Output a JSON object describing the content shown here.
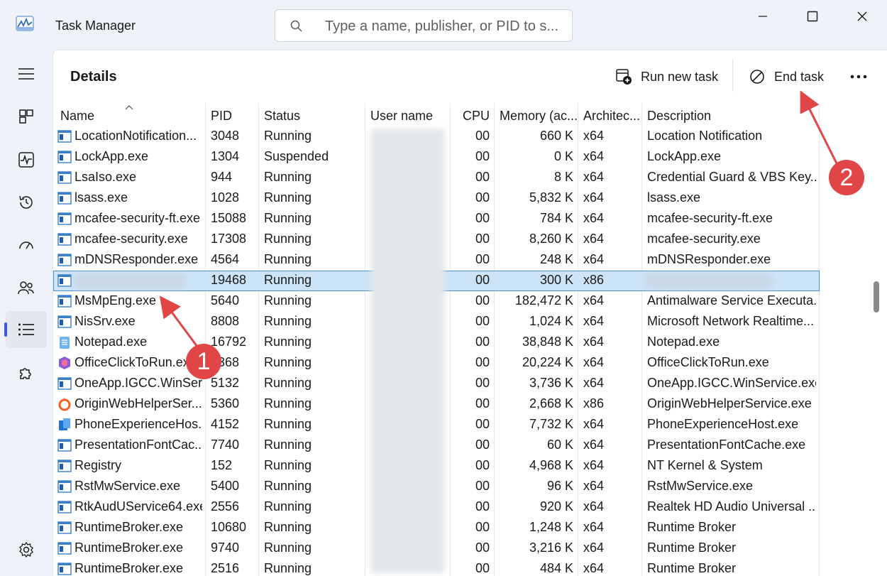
{
  "window": {
    "title": "Task Manager"
  },
  "search": {
    "placeholder": "Type a name, publisher, or PID to s..."
  },
  "toolbar": {
    "heading": "Details",
    "run_new_task": "Run new task",
    "end_task": "End task"
  },
  "columns": {
    "name": "Name",
    "pid": "PID",
    "status": "Status",
    "user": "User name",
    "cpu": "CPU",
    "memory": "Memory (ac...",
    "arch": "Architec...",
    "desc": "Description"
  },
  "rows": [
    {
      "name": "LocationNotification...",
      "pid": "3048",
      "status": "Running",
      "cpu": "00",
      "memory": "660 K",
      "arch": "x64",
      "desc": "Location Notification",
      "icon": "app"
    },
    {
      "name": "LockApp.exe",
      "pid": "1304",
      "status": "Suspended",
      "cpu": "00",
      "memory": "0 K",
      "arch": "x64",
      "desc": "LockApp.exe",
      "icon": "app"
    },
    {
      "name": "LsaIso.exe",
      "pid": "944",
      "status": "Running",
      "cpu": "00",
      "memory": "8 K",
      "arch": "x64",
      "desc": "Credential Guard & VBS Key...",
      "icon": "app"
    },
    {
      "name": "lsass.exe",
      "pid": "1028",
      "status": "Running",
      "cpu": "00",
      "memory": "5,832 K",
      "arch": "x64",
      "desc": "lsass.exe",
      "icon": "app"
    },
    {
      "name": "mcafee-security-ft.exe",
      "pid": "15088",
      "status": "Running",
      "cpu": "00",
      "memory": "784 K",
      "arch": "x64",
      "desc": "mcafee-security-ft.exe",
      "icon": "app"
    },
    {
      "name": "mcafee-security.exe",
      "pid": "17308",
      "status": "Running",
      "cpu": "00",
      "memory": "8,260 K",
      "arch": "x64",
      "desc": "mcafee-security.exe",
      "icon": "app"
    },
    {
      "name": "mDNSResponder.exe",
      "pid": "4564",
      "status": "Running",
      "cpu": "00",
      "memory": "248 K",
      "arch": "x64",
      "desc": "mDNSResponder.exe",
      "icon": "app"
    },
    {
      "name": "",
      "pid": "19468",
      "status": "Running",
      "cpu": "00",
      "memory": "300 K",
      "arch": "x86",
      "desc": "",
      "icon": "app",
      "selected": true
    },
    {
      "name": "MsMpEng.exe",
      "pid": "5640",
      "status": "Running",
      "cpu": "00",
      "memory": "182,472 K",
      "arch": "x64",
      "desc": "Antimalware Service Executa...",
      "icon": "app"
    },
    {
      "name": "NisSrv.exe",
      "pid": "8808",
      "status": "Running",
      "cpu": "00",
      "memory": "1,024 K",
      "arch": "x64",
      "desc": "Microsoft Network Realtime...",
      "icon": "app"
    },
    {
      "name": "Notepad.exe",
      "pid": "16792",
      "status": "Running",
      "cpu": "00",
      "memory": "38,848 K",
      "arch": "x64",
      "desc": "Notepad.exe",
      "icon": "notepad"
    },
    {
      "name": "OfficeClickToRun.exe",
      "pid": "5368",
      "status": "Running",
      "cpu": "00",
      "memory": "20,224 K",
      "arch": "x64",
      "desc": "OfficeClickToRun.exe",
      "icon": "office"
    },
    {
      "name": "OneApp.IGCC.WinSer...",
      "pid": "5132",
      "status": "Running",
      "cpu": "00",
      "memory": "3,736 K",
      "arch": "x64",
      "desc": "OneApp.IGCC.WinService.exe",
      "icon": "app"
    },
    {
      "name": "OriginWebHelperSer...",
      "pid": "5360",
      "status": "Running",
      "cpu": "00",
      "memory": "2,668 K",
      "arch": "x86",
      "desc": "OriginWebHelperService.exe",
      "icon": "origin"
    },
    {
      "name": "PhoneExperienceHos...",
      "pid": "4152",
      "status": "Running",
      "cpu": "00",
      "memory": "7,732 K",
      "arch": "x64",
      "desc": "PhoneExperienceHost.exe",
      "icon": "phone"
    },
    {
      "name": "PresentationFontCac...",
      "pid": "7740",
      "status": "Running",
      "cpu": "00",
      "memory": "60 K",
      "arch": "x64",
      "desc": "PresentationFontCache.exe",
      "icon": "app"
    },
    {
      "name": "Registry",
      "pid": "152",
      "status": "Running",
      "cpu": "00",
      "memory": "4,968 K",
      "arch": "x64",
      "desc": "NT Kernel & System",
      "icon": "app"
    },
    {
      "name": "RstMwService.exe",
      "pid": "5400",
      "status": "Running",
      "cpu": "00",
      "memory": "96 K",
      "arch": "x64",
      "desc": "RstMwService.exe",
      "icon": "app"
    },
    {
      "name": "RtkAudUService64.exe",
      "pid": "2556",
      "status": "Running",
      "cpu": "00",
      "memory": "920 K",
      "arch": "x64",
      "desc": "Realtek HD Audio Universal ...",
      "icon": "app"
    },
    {
      "name": "RuntimeBroker.exe",
      "pid": "10680",
      "status": "Running",
      "cpu": "00",
      "memory": "1,248 K",
      "arch": "x64",
      "desc": "Runtime Broker",
      "icon": "app"
    },
    {
      "name": "RuntimeBroker.exe",
      "pid": "9740",
      "status": "Running",
      "cpu": "00",
      "memory": "3,216 K",
      "arch": "x64",
      "desc": "Runtime Broker",
      "icon": "app"
    },
    {
      "name": "RuntimeBroker.exe",
      "pid": "2516",
      "status": "Running",
      "cpu": "00",
      "memory": "484 K",
      "arch": "x64",
      "desc": "Runtime Broker",
      "icon": "app"
    }
  ],
  "annotations": {
    "one": "1",
    "two": "2"
  },
  "colors": {
    "accent": "#3b5bdb",
    "selection": "#cce4f7",
    "callout": "#e04646"
  }
}
